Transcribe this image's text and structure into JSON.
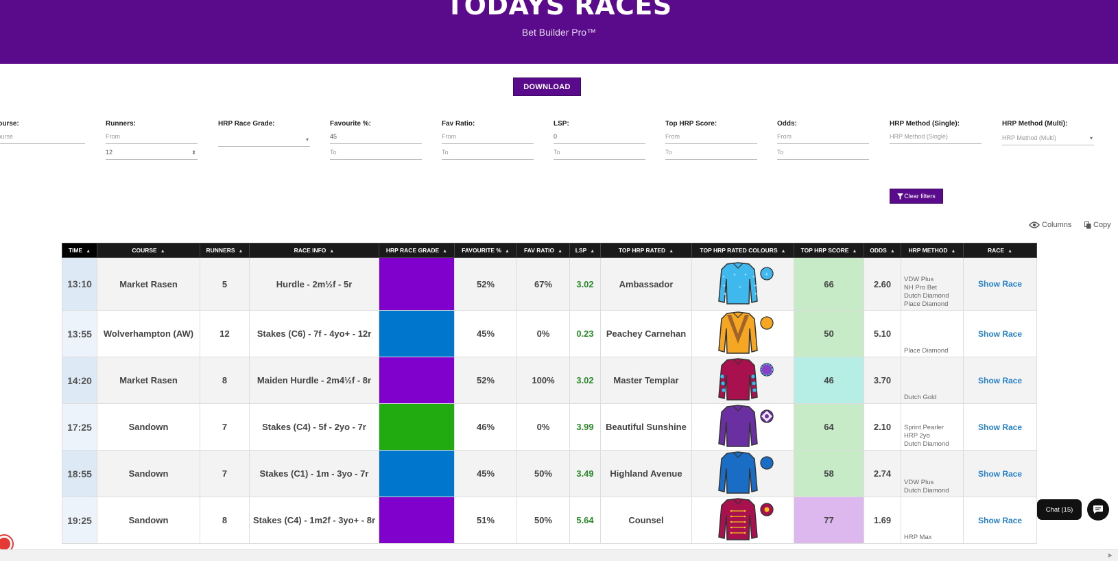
{
  "header": {
    "title": "TODAYS RACES",
    "subtitle": "Bet Builder Pro™"
  },
  "download_label": "DOWNLOAD",
  "filters": {
    "course": {
      "label": "Course:",
      "placeholder": "Course"
    },
    "runners": {
      "label": "Runners:",
      "from": "From",
      "to_value": "12"
    },
    "grade": {
      "label": "HRP Race Grade:"
    },
    "favourite": {
      "label": "Favourite %:",
      "from_value": "45",
      "to": "To"
    },
    "fav_ratio": {
      "label": "Fav Ratio:",
      "from": "From",
      "to": "To"
    },
    "lsp": {
      "label": "LSP:",
      "from_value": "0",
      "to": "To"
    },
    "top_score": {
      "label": "Top HRP Score:",
      "from": "From",
      "to": "To"
    },
    "odds": {
      "label": "Odds:",
      "from": "From",
      "to": "To"
    },
    "method_single": {
      "label": "HRP Method (Single):",
      "placeholder": "HRP Method (Single)"
    },
    "method_multi": {
      "label": "HRP Method (Multi):",
      "placeholder": "HRP Method (Multi)"
    }
  },
  "clear_filters_label": "Clear filters",
  "toolbar": {
    "columns_label": "Columns",
    "copy_label": "Copy"
  },
  "table": {
    "headers": [
      "TIME",
      "COURSE",
      "RUNNERS",
      "RACE INFO",
      "HRP RACE GRADE",
      "FAVOURITE %",
      "FAV RATIO",
      "LSP",
      "TOP HRP RATED",
      "TOP HRP RATED COLOURS",
      "TOP HRP SCORE",
      "ODDS",
      "HRP METHOD",
      "RACE"
    ],
    "show_label": "Show Race",
    "rows": [
      {
        "time": "13:10",
        "course": "Market Rasen",
        "runners": "5",
        "info": "Hurdle - 2m½f - 5r",
        "grade_color": "#8000cc",
        "fav": "52%",
        "ratio": "67%",
        "lsp": "3.02",
        "top": "Ambassador",
        "silk": {
          "body": "#3fb8ee",
          "sleeve": "#3fb8ee",
          "accent": "#3fb8ee",
          "pattern": "stars",
          "cap": "#3fb8ee"
        },
        "score": "66",
        "score_color": "#c6ebc6",
        "odds": "2.60",
        "methods": [
          "VDW Plus",
          "NH Pro Bet",
          "Dutch Diamond",
          "Place Diamond"
        ]
      },
      {
        "time": "13:55",
        "course": "Wolverhampton (AW)",
        "runners": "12",
        "info": "Stakes (C6) - 7f - 4yo+ - 12r",
        "grade_color": "#0077cc",
        "fav": "45%",
        "ratio": "0%",
        "lsp": "0.23",
        "top": "Peachey Carnehan",
        "silk": {
          "body": "#f5a623",
          "sleeve": "#f5a623",
          "accent": "#a0642a",
          "pattern": "chevron",
          "cap": "#f5a623"
        },
        "score": "50",
        "score_color": "#c6ebc6",
        "odds": "5.10",
        "methods": [
          "Place Diamond"
        ]
      },
      {
        "time": "14:20",
        "course": "Market Rasen",
        "runners": "8",
        "info": "Maiden Hurdle - 2m4½f - 8r",
        "grade_color": "#8000cc",
        "fav": "52%",
        "ratio": "100%",
        "lsp": "3.02",
        "top": "Master Templar",
        "silk": {
          "body": "#a8104e",
          "sleeve": "#a8104e",
          "accent": "#3fb8ee",
          "pattern": "spots",
          "cap": "#8a3fc4"
        },
        "score": "46",
        "score_color": "#b6eee6",
        "odds": "3.70",
        "methods": [
          "Dutch Gold"
        ]
      },
      {
        "time": "17:25",
        "course": "Sandown",
        "runners": "7",
        "info": "Stakes (C4) - 5f - 2yo - 7r",
        "grade_color": "#22aa11",
        "fav": "46%",
        "ratio": "0%",
        "lsp": "3.99",
        "top": "Beautiful Sunshine",
        "silk": {
          "body": "#6a2fa0",
          "sleeve": "#6a2fa0",
          "accent": "#ffffff",
          "pattern": "plain",
          "cap": "#6a2fa0"
        },
        "score": "64",
        "score_color": "#c6ebc6",
        "odds": "2.10",
        "methods": [
          "Sprint Pearler",
          "HRP 2yo",
          "Dutch Diamond"
        ]
      },
      {
        "time": "18:55",
        "course": "Sandown",
        "runners": "7",
        "info": "Stakes (C1) - 1m - 3yo - 7r",
        "grade_color": "#0077cc",
        "fav": "45%",
        "ratio": "50%",
        "lsp": "3.49",
        "top": "Highland Avenue",
        "silk": {
          "body": "#1a6dc4",
          "sleeve": "#1a6dc4",
          "accent": "#1a6dc4",
          "pattern": "plain",
          "cap": "#1a6dc4"
        },
        "score": "58",
        "score_color": "#c6ebc6",
        "odds": "2.74",
        "methods": [
          "VDW Plus",
          "Dutch Diamond"
        ]
      },
      {
        "time": "19:25",
        "course": "Sandown",
        "runners": "8",
        "info": "Stakes (C4) - 1m2f - 3yo+ - 8r",
        "grade_color": "#8000cc",
        "fav": "51%",
        "ratio": "50%",
        "lsp": "5.64",
        "top": "Counsel",
        "silk": {
          "body": "#a8104e",
          "sleeve": "#a8104e",
          "accent": "#f0c419",
          "pattern": "braid",
          "cap": "#a8104e"
        },
        "score": "77",
        "score_color": "#ddb8ee",
        "odds": "1.69",
        "methods": [
          "HRP Max"
        ]
      }
    ]
  },
  "chat_label": "Chat (15)"
}
